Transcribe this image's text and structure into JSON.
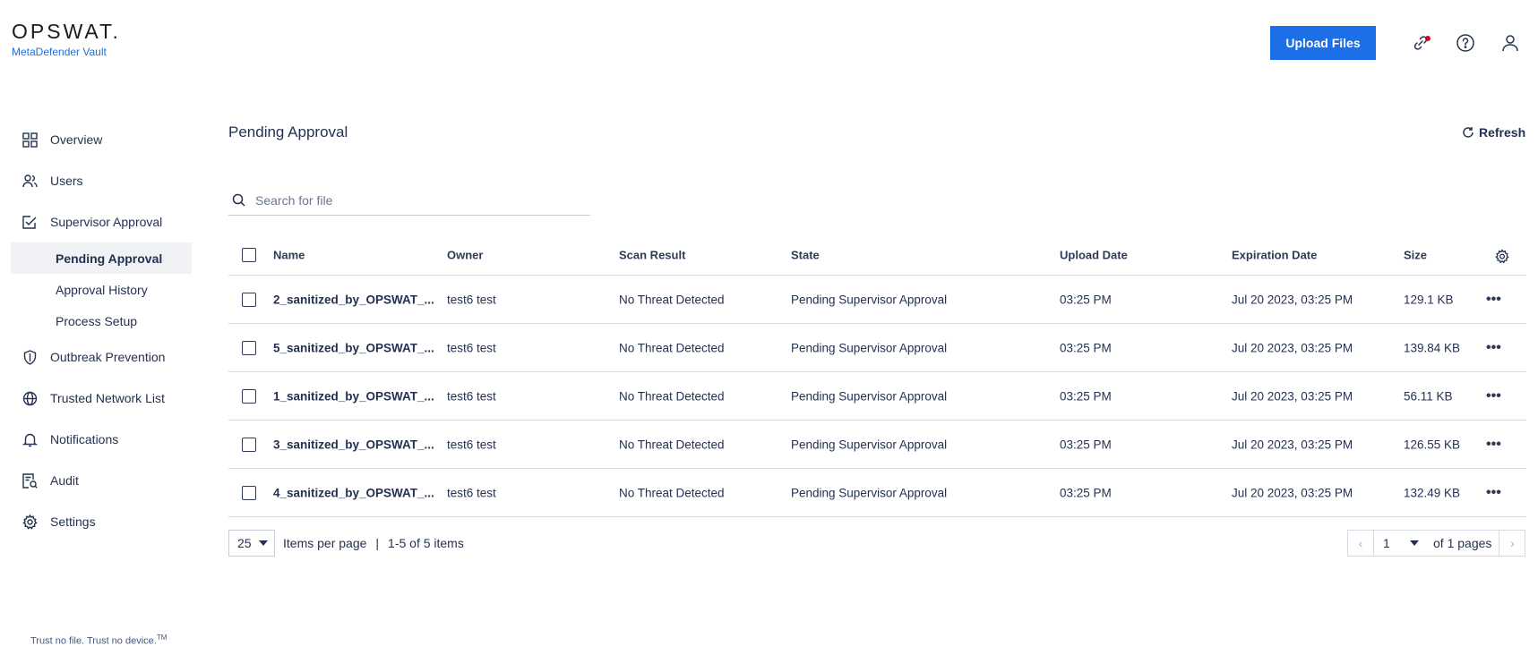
{
  "header": {
    "logo": "OPSWAT.",
    "product": "MetaDefender Vault",
    "upload_label": "Upload Files"
  },
  "sidebar": {
    "items": [
      {
        "label": "Overview",
        "icon": "grid-icon"
      },
      {
        "label": "Users",
        "icon": "users-icon"
      },
      {
        "label": "Supervisor Approval",
        "icon": "checkbox-edit-icon"
      },
      {
        "label": "Outbreak Prevention",
        "icon": "shield-icon"
      },
      {
        "label": "Trusted Network List",
        "icon": "globe-icon"
      },
      {
        "label": "Notifications",
        "icon": "bell-icon"
      },
      {
        "label": "Audit",
        "icon": "audit-icon"
      },
      {
        "label": "Settings",
        "icon": "gear-icon"
      }
    ],
    "subitems": [
      {
        "label": "Pending Approval",
        "active": true
      },
      {
        "label": "Approval History",
        "active": false
      },
      {
        "label": "Process Setup",
        "active": false
      }
    ],
    "tagline": "Trust no file. Trust no device.",
    "tagline_tm": "TM"
  },
  "main": {
    "title": "Pending Approval",
    "refresh_label": "Refresh",
    "search_placeholder": "Search for file"
  },
  "table": {
    "columns": [
      "Name",
      "Owner",
      "Scan Result",
      "State",
      "Upload Date",
      "Expiration Date",
      "Size"
    ],
    "rows": [
      {
        "name": "2_sanitized_by_OPSWAT_...",
        "owner": "test6 test",
        "scan": "No Threat Detected",
        "state": "Pending Supervisor Approval",
        "upload": "03:25 PM",
        "expiration": "Jul 20 2023, 03:25 PM",
        "size": "129.1 KB"
      },
      {
        "name": "5_sanitized_by_OPSWAT_...",
        "owner": "test6 test",
        "scan": "No Threat Detected",
        "state": "Pending Supervisor Approval",
        "upload": "03:25 PM",
        "expiration": "Jul 20 2023, 03:25 PM",
        "size": "139.84 KB"
      },
      {
        "name": "1_sanitized_by_OPSWAT_...",
        "owner": "test6 test",
        "scan": "No Threat Detected",
        "state": "Pending Supervisor Approval",
        "upload": "03:25 PM",
        "expiration": "Jul 20 2023, 03:25 PM",
        "size": "56.11 KB"
      },
      {
        "name": "3_sanitized_by_OPSWAT_...",
        "owner": "test6 test",
        "scan": "No Threat Detected",
        "state": "Pending Supervisor Approval",
        "upload": "03:25 PM",
        "expiration": "Jul 20 2023, 03:25 PM",
        "size": "126.55 KB"
      },
      {
        "name": "4_sanitized_by_OPSWAT_...",
        "owner": "test6 test",
        "scan": "No Threat Detected",
        "state": "Pending Supervisor Approval",
        "upload": "03:25 PM",
        "expiration": "Jul 20 2023, 03:25 PM",
        "size": "132.49 KB"
      }
    ]
  },
  "pagination": {
    "per_page": "25",
    "per_page_label": "Items per page",
    "separator": "|",
    "range_label": "1-5 of 5 items",
    "current_page": "1",
    "of_pages_label": "of 1 pages"
  },
  "colors": {
    "accent": "#1d6fe8",
    "notification_dot": "#d0021b",
    "active_bg": "#f0f2f6"
  }
}
